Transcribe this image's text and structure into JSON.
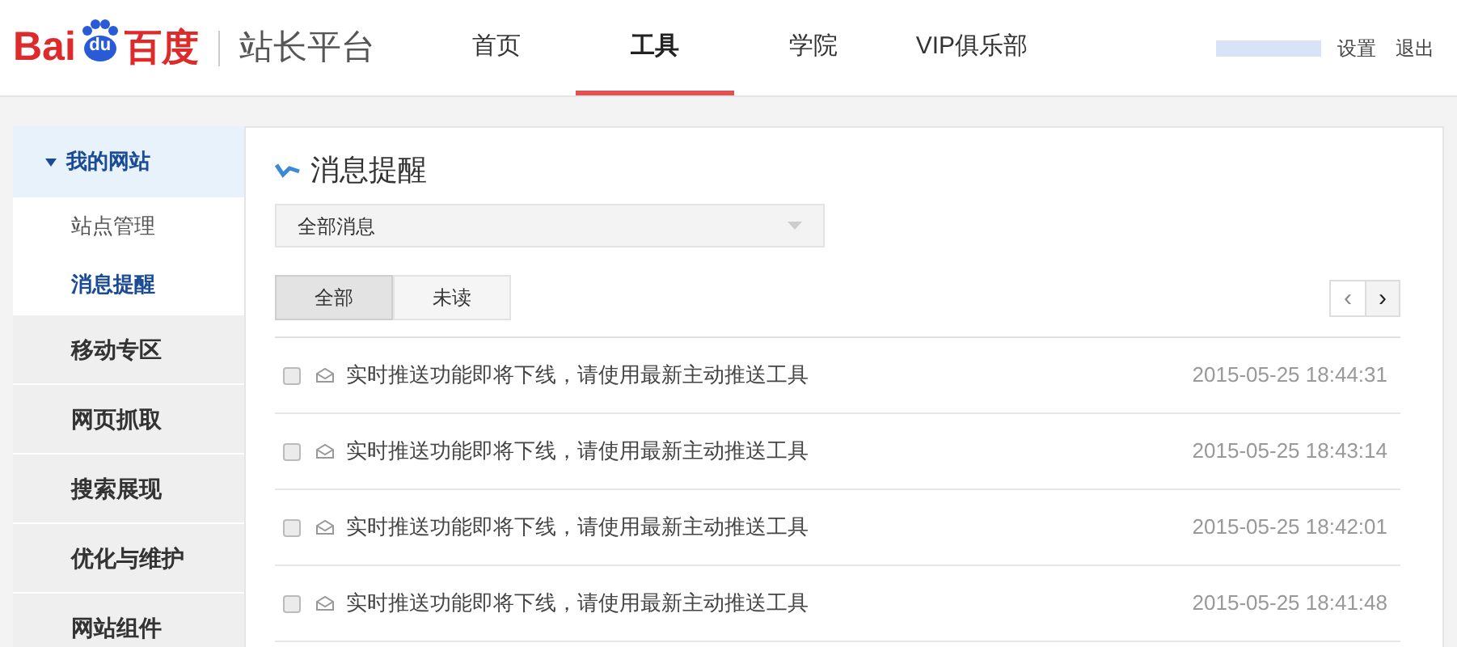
{
  "logo": {
    "part_1": "Bai",
    "part_2": "du",
    "part_3": "百度"
  },
  "site_title": "站长平台",
  "nav": [
    {
      "label": "首页",
      "selected": false
    },
    {
      "label": "工具",
      "selected": true
    },
    {
      "label": "学院",
      "selected": false
    },
    {
      "label": "VIP俱乐部",
      "selected": false
    }
  ],
  "user_links": [
    "设置",
    "退出"
  ],
  "sidebar": {
    "group": {
      "label": "我的网站",
      "expanded": true,
      "children": [
        {
          "label": "站点管理",
          "selected": false
        },
        {
          "label": "消息提醒",
          "selected": true
        }
      ]
    },
    "sections": [
      "移动专区",
      "网页抓取",
      "搜索展现",
      "优化与维护",
      "网站组件"
    ]
  },
  "panel": {
    "title": "消息提醒",
    "filter": {
      "value": "全部消息"
    },
    "tabs": [
      {
        "label": "全部",
        "selected": true
      },
      {
        "label": "未读",
        "selected": false
      }
    ],
    "pager": [
      "‹",
      "›"
    ],
    "messages": [
      {
        "checked": false,
        "text": "实时推送功能即将下线，请使用最新主动推送工具",
        "time": "2015-05-25 18:44:31"
      },
      {
        "checked": false,
        "text": "实时推送功能即将下线，请使用最新主动推送工具",
        "time": "2015-05-25 18:43:14"
      },
      {
        "checked": false,
        "text": "实时推送功能即将下线，请使用最新主动推送工具",
        "time": "2015-05-25 18:42:01"
      },
      {
        "checked": false,
        "text": "实时推送功能即将下线，请使用最新主动推送工具",
        "time": "2015-05-25 18:41:48"
      }
    ]
  }
}
